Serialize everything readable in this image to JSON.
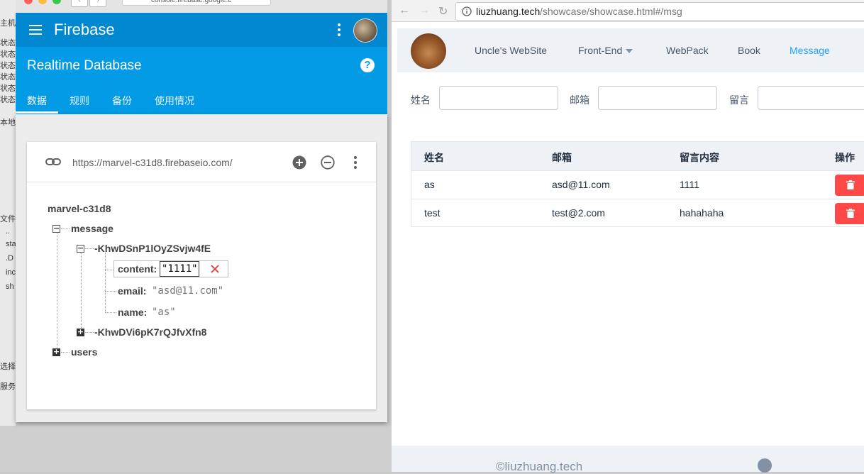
{
  "background": {
    "left_rows": [
      "主机(",
      "状态:",
      "状态:",
      "状态:",
      "状态:",
      "状态:",
      "状态:",
      "本地",
      "文件名",
      "..",
      "sta",
      ".D",
      "inc",
      "sh",
      "选择了",
      "服务器"
    ]
  },
  "firebase": {
    "chrome": {
      "url": "console.firebase.google.c"
    },
    "appbar_title": "Firebase",
    "subtitle": "Realtime Database",
    "help": "?",
    "tabs": [
      {
        "label": "数据",
        "active": true
      },
      {
        "label": "规则",
        "active": false
      },
      {
        "label": "备份",
        "active": false
      },
      {
        "label": "使用情况",
        "active": false
      }
    ],
    "db_url": "https://marvel-c31d8.firebaseio.com/",
    "tree": {
      "root": "marvel-c31d8",
      "message": "message",
      "entry1_key": "-KhwDSnP1lOyZSvjw4fE",
      "content_key": "content:",
      "content_value": "\"1111\"",
      "email_key": "email:",
      "email_value": "\"asd@11.com\"",
      "name_key": "name:",
      "name_value": "\"as\"",
      "entry2_key": "-KhwDVi6pK7rQJfvXfn8",
      "users": "users"
    },
    "colors": {
      "primary": "#0288d1",
      "secondary": "#039be5"
    }
  },
  "browser": {
    "url_host": "liuzhuang.tech",
    "url_path": "/showcase/showcase.html#/msg",
    "nav": {
      "items": [
        {
          "label": "Uncle's WebSite",
          "active": false
        },
        {
          "label": "Front-End",
          "active": false,
          "dropdown": true
        },
        {
          "label": "WebPack",
          "active": false
        },
        {
          "label": "Book",
          "active": false
        },
        {
          "label": "Message",
          "active": true
        }
      ]
    },
    "form": {
      "name_label": "姓名",
      "email_label": "邮箱",
      "message_label": "留言",
      "name_value": "",
      "email_value": "",
      "message_value": ""
    },
    "table": {
      "headers": [
        "姓名",
        "邮箱",
        "留言内容",
        "操作"
      ],
      "rows": [
        {
          "name": "as",
          "email": "asd@11.com",
          "content": "1111"
        },
        {
          "name": "test",
          "email": "test@2.com",
          "content": "hahahaha"
        }
      ]
    },
    "footer": {
      "copyright": "©liuzhuang.tech"
    },
    "colors": {
      "accent": "#20a0ff",
      "danger": "#ff4949"
    }
  }
}
